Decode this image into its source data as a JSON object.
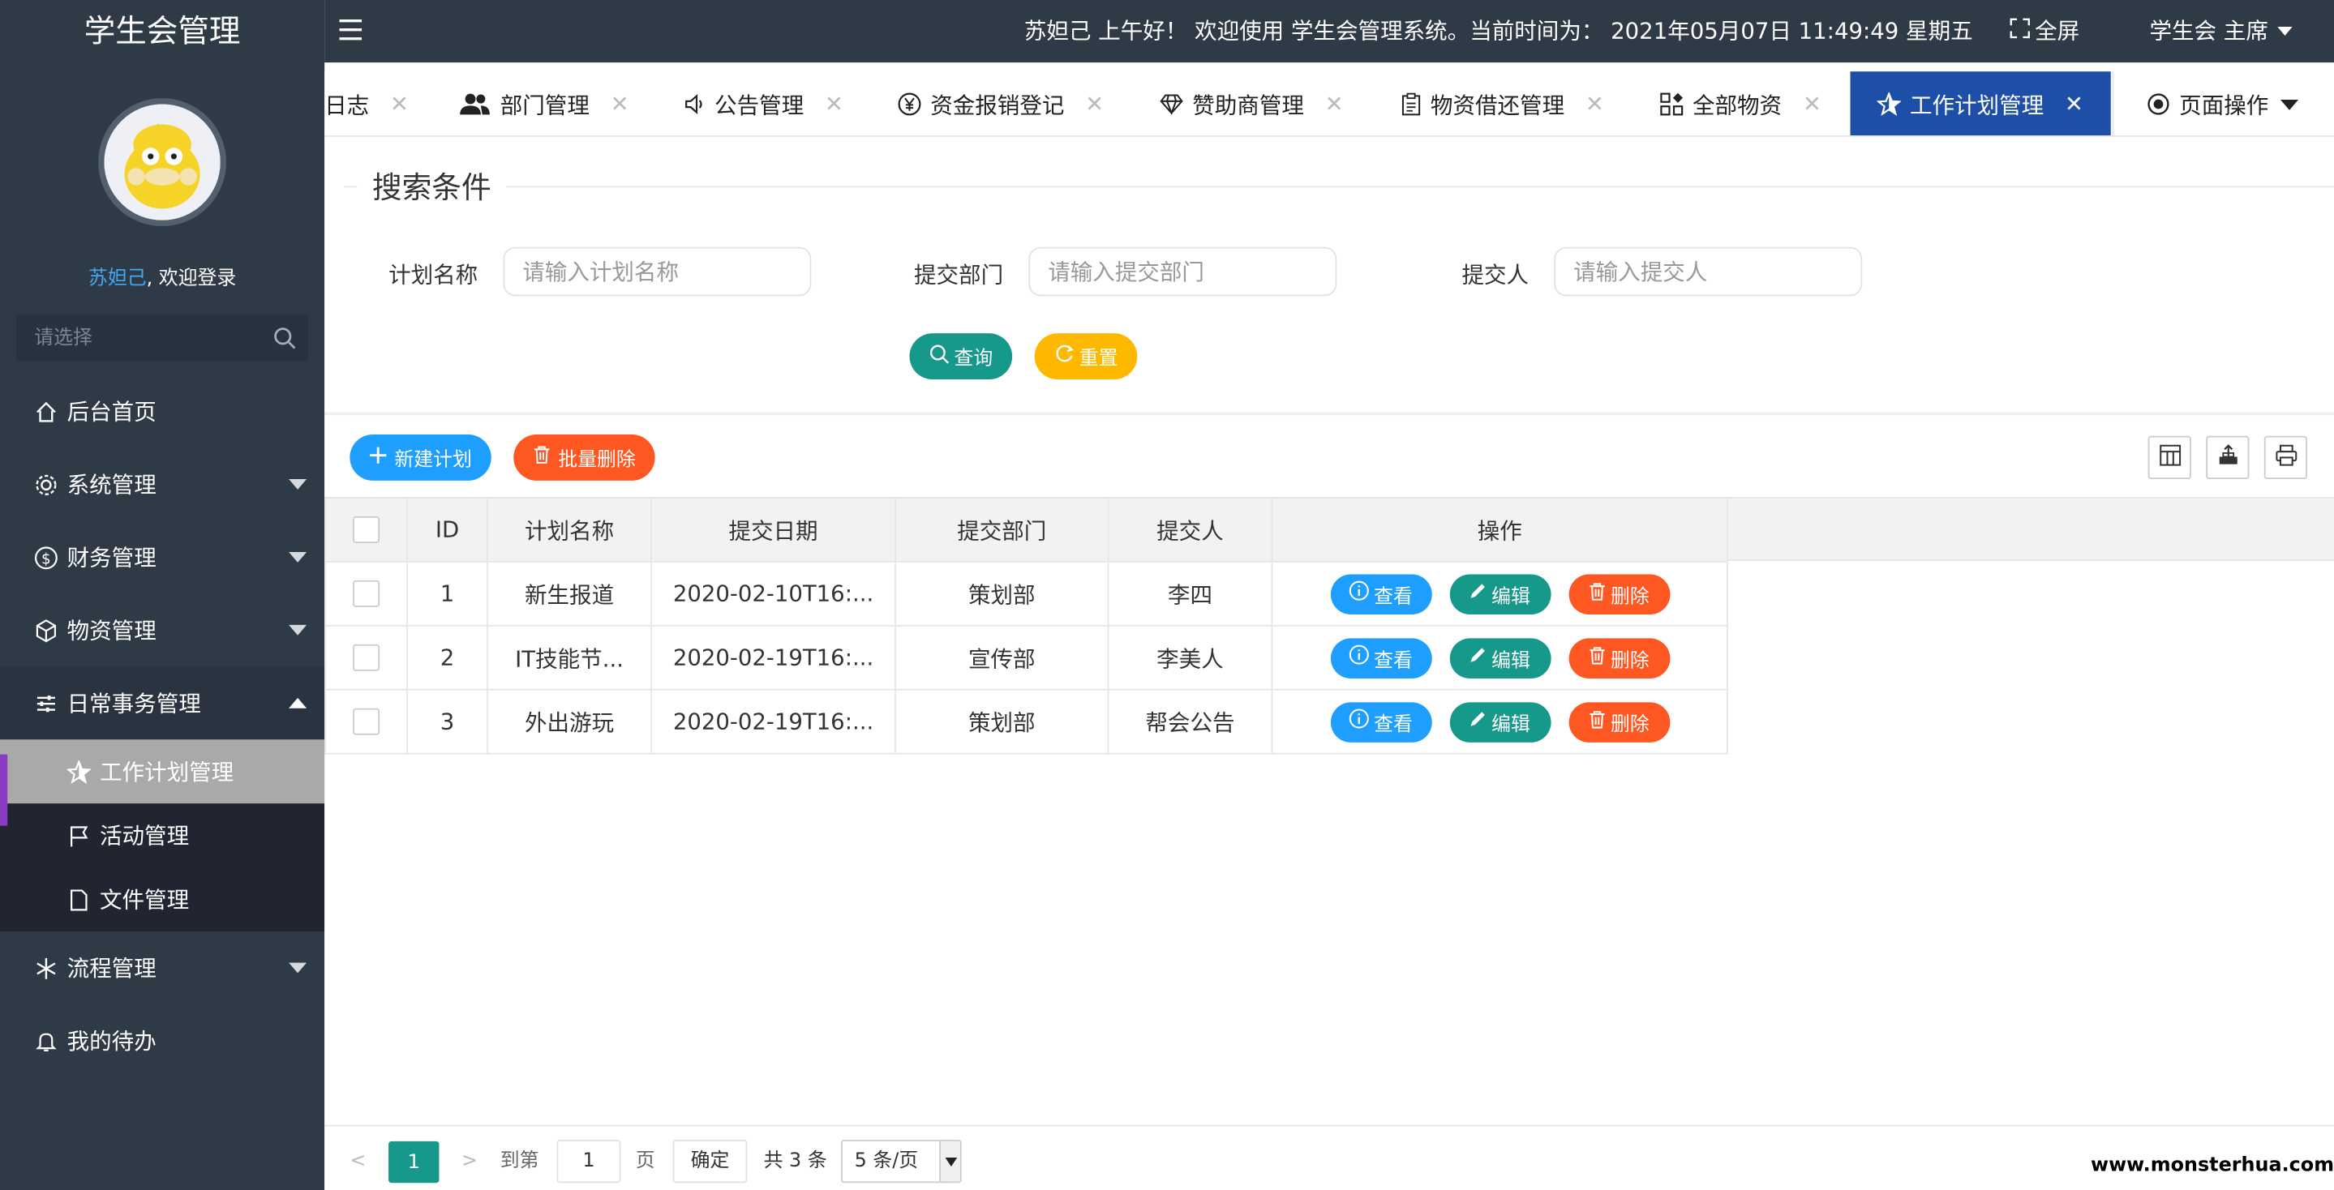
{
  "app": {
    "title": "学生会管理"
  },
  "sidebar": {
    "username": "苏妲己",
    "welcome_suffix": ", 欢迎登录",
    "search_placeholder": "请选择",
    "items": [
      {
        "label": "后台首页",
        "icon": "home-icon"
      },
      {
        "label": "系统管理",
        "icon": "gear-icon"
      },
      {
        "label": "财务管理",
        "icon": "dollar-icon"
      },
      {
        "label": "物资管理",
        "icon": "cube-icon"
      },
      {
        "label": "日常事务管理",
        "icon": "sliders-icon"
      },
      {
        "label": "流程管理",
        "icon": "snowflake-icon"
      },
      {
        "label": "我的待办",
        "icon": "bell-icon"
      }
    ],
    "subitems": [
      {
        "label": "工作计划管理",
        "icon": "star-icon"
      },
      {
        "label": "活动管理",
        "icon": "flag-icon"
      },
      {
        "label": "文件管理",
        "icon": "file-icon"
      }
    ]
  },
  "topbar": {
    "greeting": "苏妲己 上午好！ 欢迎使用 学生会管理系统。当前时间为： 2021年05月07日 11:49:49   星期五",
    "fullscreen": "全屏",
    "user_role": "学生会 主席"
  },
  "tabs": [
    {
      "label": "日志"
    },
    {
      "label": "部门管理",
      "icon": "users-icon"
    },
    {
      "label": "公告管理",
      "icon": "speaker-icon"
    },
    {
      "label": "资金报销登记",
      "icon": "yen-icon"
    },
    {
      "label": "赞助商管理",
      "icon": "diamond-icon"
    },
    {
      "label": "物资借还管理",
      "icon": "clipboard-icon"
    },
    {
      "label": "全部物资",
      "icon": "apps-icon"
    },
    {
      "label": "工作计划管理",
      "icon": "star-icon",
      "active": true
    },
    {
      "label": "页面操作",
      "icon": "target-icon"
    }
  ],
  "search": {
    "legend": "搜索条件",
    "fields": [
      {
        "label": "计划名称",
        "placeholder": "请输入计划名称"
      },
      {
        "label": "提交部门",
        "placeholder": "请输入提交部门"
      },
      {
        "label": "提交人",
        "placeholder": "请输入提交人"
      }
    ],
    "query_label": "查询",
    "reset_label": "重置"
  },
  "toolbar": {
    "new_label": "新建计划",
    "batch_delete_label": "批量删除"
  },
  "table": {
    "headers": [
      "ID",
      "计划名称",
      "提交日期",
      "提交部门",
      "提交人",
      "操作"
    ],
    "rows": [
      {
        "id": "1",
        "name": "新生报道",
        "date": "2020-02-10T16:...",
        "dept": "策划部",
        "person": "李四"
      },
      {
        "id": "2",
        "name": "IT技能节...",
        "date": "2020-02-19T16:...",
        "dept": "宣传部",
        "person": "李美人"
      },
      {
        "id": "3",
        "name": "外出游玩",
        "date": "2020-02-19T16:...",
        "dept": "策划部",
        "person": "帮会公告"
      }
    ],
    "actions": {
      "view": "查看",
      "edit": "编辑",
      "delete": "删除"
    }
  },
  "pager": {
    "current": "1",
    "goto_label": "到第",
    "goto_value": "1",
    "page_label": "页",
    "confirm": "确定",
    "total": "共 3 条",
    "page_size": "5 条/页"
  },
  "watermark": "www.monsterhua.com",
  "colors": {
    "sidebar_bg": "#2f3a47",
    "active_tab": "#1e4fa8",
    "teal": "#16998a",
    "yellow": "#ffb800",
    "blue": "#1e9fff",
    "orange": "#ff5722"
  }
}
